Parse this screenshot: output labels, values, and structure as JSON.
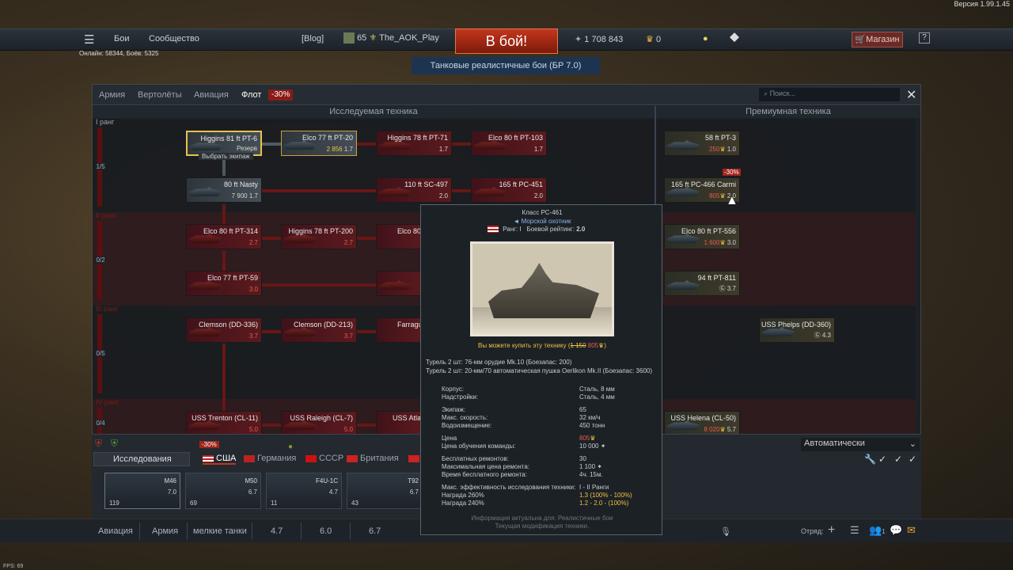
{
  "version": "Версия 1.99.1.45",
  "topbar": {
    "menu_icon": "hamburger-icon",
    "battles": "Бои",
    "community": "Сообщество",
    "blog": "[Blog]",
    "level": "65",
    "username": "The_AOK_Play",
    "battle_button": "В бой!",
    "silver_lions": "1 708 843",
    "golden_eagles": "0",
    "shop": "Магазин",
    "help": "?"
  },
  "online": "Онлайн: 58344, Боёв: 5325",
  "mode": "Танковые реалистичные бои (БР 7.0)",
  "window": {
    "tabs": [
      "Армия",
      "Вертолёты",
      "Авиация",
      "Флот"
    ],
    "fleet_discount": "-30%",
    "search_placeholder": "Поиск...",
    "researched_header": "Исследуемая техника",
    "premium_header": "Премиумная техника",
    "ranks": [
      "I ранг",
      "II ранг",
      "III ранг",
      "IV ранг"
    ],
    "rank_progress": [
      "1/5",
      "0/2",
      "0/5",
      "0/4"
    ]
  },
  "tree": {
    "higgins81": {
      "name": "Higgins 81 ft PT-6",
      "status": "Резерв",
      "sub": "Выбрать экипаж"
    },
    "elco77_20": {
      "name": "Elco 77 ft PT-20",
      "cost": "2 856",
      "br": "1.7"
    },
    "higgins78_71": {
      "name": "Higgins 78 ft PT-71",
      "br": "1.7"
    },
    "elco80_103": {
      "name": "Elco 80 ft PT-103",
      "br": "1.7"
    },
    "nasty": {
      "name": "80 ft Nasty",
      "cost": "7 900",
      "br": "1.7"
    },
    "sc497": {
      "name": "110 ft SC-497",
      "br": "2.0"
    },
    "pc451": {
      "name": "165 ft PC-451",
      "br": "2.0"
    },
    "elco80_314": {
      "name": "Elco 80 ft PT-314",
      "br": "2.7"
    },
    "higgins78_200": {
      "name": "Higgins 78 ft PT-200",
      "br": "2.7"
    },
    "elco80_trunc": {
      "name": "Elco 80"
    },
    "elco77_59": {
      "name": "Elco 77 ft PT-59",
      "br": "3.0"
    },
    "clemson336": {
      "name": "Clemson (DD-336)",
      "br": "3.7"
    },
    "clemson213": {
      "name": "Clemson (DD-213)",
      "br": "3.7"
    },
    "farragut": {
      "name": "Farragut"
    },
    "trenton": {
      "name": "USS Trenton (CL-11)",
      "br": "5.0"
    },
    "raleigh": {
      "name": "USS Raleigh (CL-7)",
      "br": "5.0"
    },
    "atlanta": {
      "name": "USS Atlan"
    }
  },
  "premium": {
    "pt3": {
      "name": "58 ft PT-3",
      "cost": "250",
      "br": "1.0"
    },
    "pc466": {
      "name": "165 ft PC-466 Carmi",
      "cost": "805",
      "br": "2.0",
      "discount": "-30%"
    },
    "pt556": {
      "name": "Elco 80 ft PT-556",
      "cost": "1 600",
      "br": "3.0"
    },
    "pt811": {
      "name": "94 ft PT-811",
      "br": "3.7"
    },
    "phelps": {
      "name": "USS Phelps (DD-360)",
      "br": "4.3"
    },
    "helena": {
      "name": "USS Helena (CL-50)",
      "cost": "8 020",
      "br": "5.7"
    }
  },
  "tooltip": {
    "class": "Класс PC-461",
    "role": "◄ Морской охотник",
    "rank_label": "Ранг: I",
    "rating_label": "Боевой рейтинг:",
    "rating": "2.0",
    "buy_text": "Вы можете купить эту технику",
    "old_price": "1 150",
    "new_price": "805",
    "turret1": "Турель 2 шт: 76-мм орудие Mk.10 (Боезапас: 200)",
    "turret2": "Турель 2 шт: 20-мм/70 автоматическая пушка Oerlikon Mk.II (Боезапас: 3600)",
    "stats": [
      {
        "k": "Корпус:",
        "v": "Сталь, 8 мм"
      },
      {
        "k": "Надстройки:",
        "v": "Сталь, 4 мм"
      },
      {
        "k": "Экипаж:",
        "v": "65"
      },
      {
        "k": "Макс. скорость:",
        "v": "32 км/ч"
      },
      {
        "k": "Водоизмещение:",
        "v": "450 тонн"
      },
      {
        "k": "Цена",
        "v": "805"
      },
      {
        "k": "Цена обучения команды:",
        "v": "10 000"
      },
      {
        "k": "Бесплатных ремонтов:",
        "v": "30"
      },
      {
        "k": "Максимальная цена ремонта:",
        "v": "1 100"
      },
      {
        "k": "Время бесплатного ремонта:",
        "v": "4ч. 15м."
      },
      {
        "k": "Макс. эффективность исследования техники:",
        "v": "I - II Ранги"
      },
      {
        "k": "Награда 260%",
        "v": "1.3 (100% - 100%)"
      },
      {
        "k": "Награда 240%",
        "v": "1.2 - 2.0 - (100%)"
      }
    ],
    "footer1": "Информация актуальна для: Реалистичные бои",
    "footer2": "Текущая модификация техники."
  },
  "bottom": {
    "discount": "-30%",
    "research": "Исследования",
    "nations": [
      "США",
      "Германия",
      "СССР",
      "Британия"
    ],
    "auto": "Автоматически",
    "slots": [
      {
        "name": "M46",
        "br": "7.0",
        "count": "119"
      },
      {
        "name": "M50",
        "br": "6.7",
        "count": "69"
      },
      {
        "name": "F4U-1C",
        "br": "4.7",
        "count": "11"
      },
      {
        "name": "T92",
        "br": "6.7",
        "count": "43"
      }
    ]
  },
  "statusbar": {
    "items": [
      "Авиация",
      "Армия",
      "мелкие танки",
      "4.7",
      "6.0",
      "6.7"
    ],
    "squad": "Отряд:",
    "chat_badge": "1"
  },
  "fps": "FPS: 69",
  "colors": {
    "accent": "#c2361d",
    "gold": "#f0c040",
    "research_red": "#5a1a1e"
  }
}
